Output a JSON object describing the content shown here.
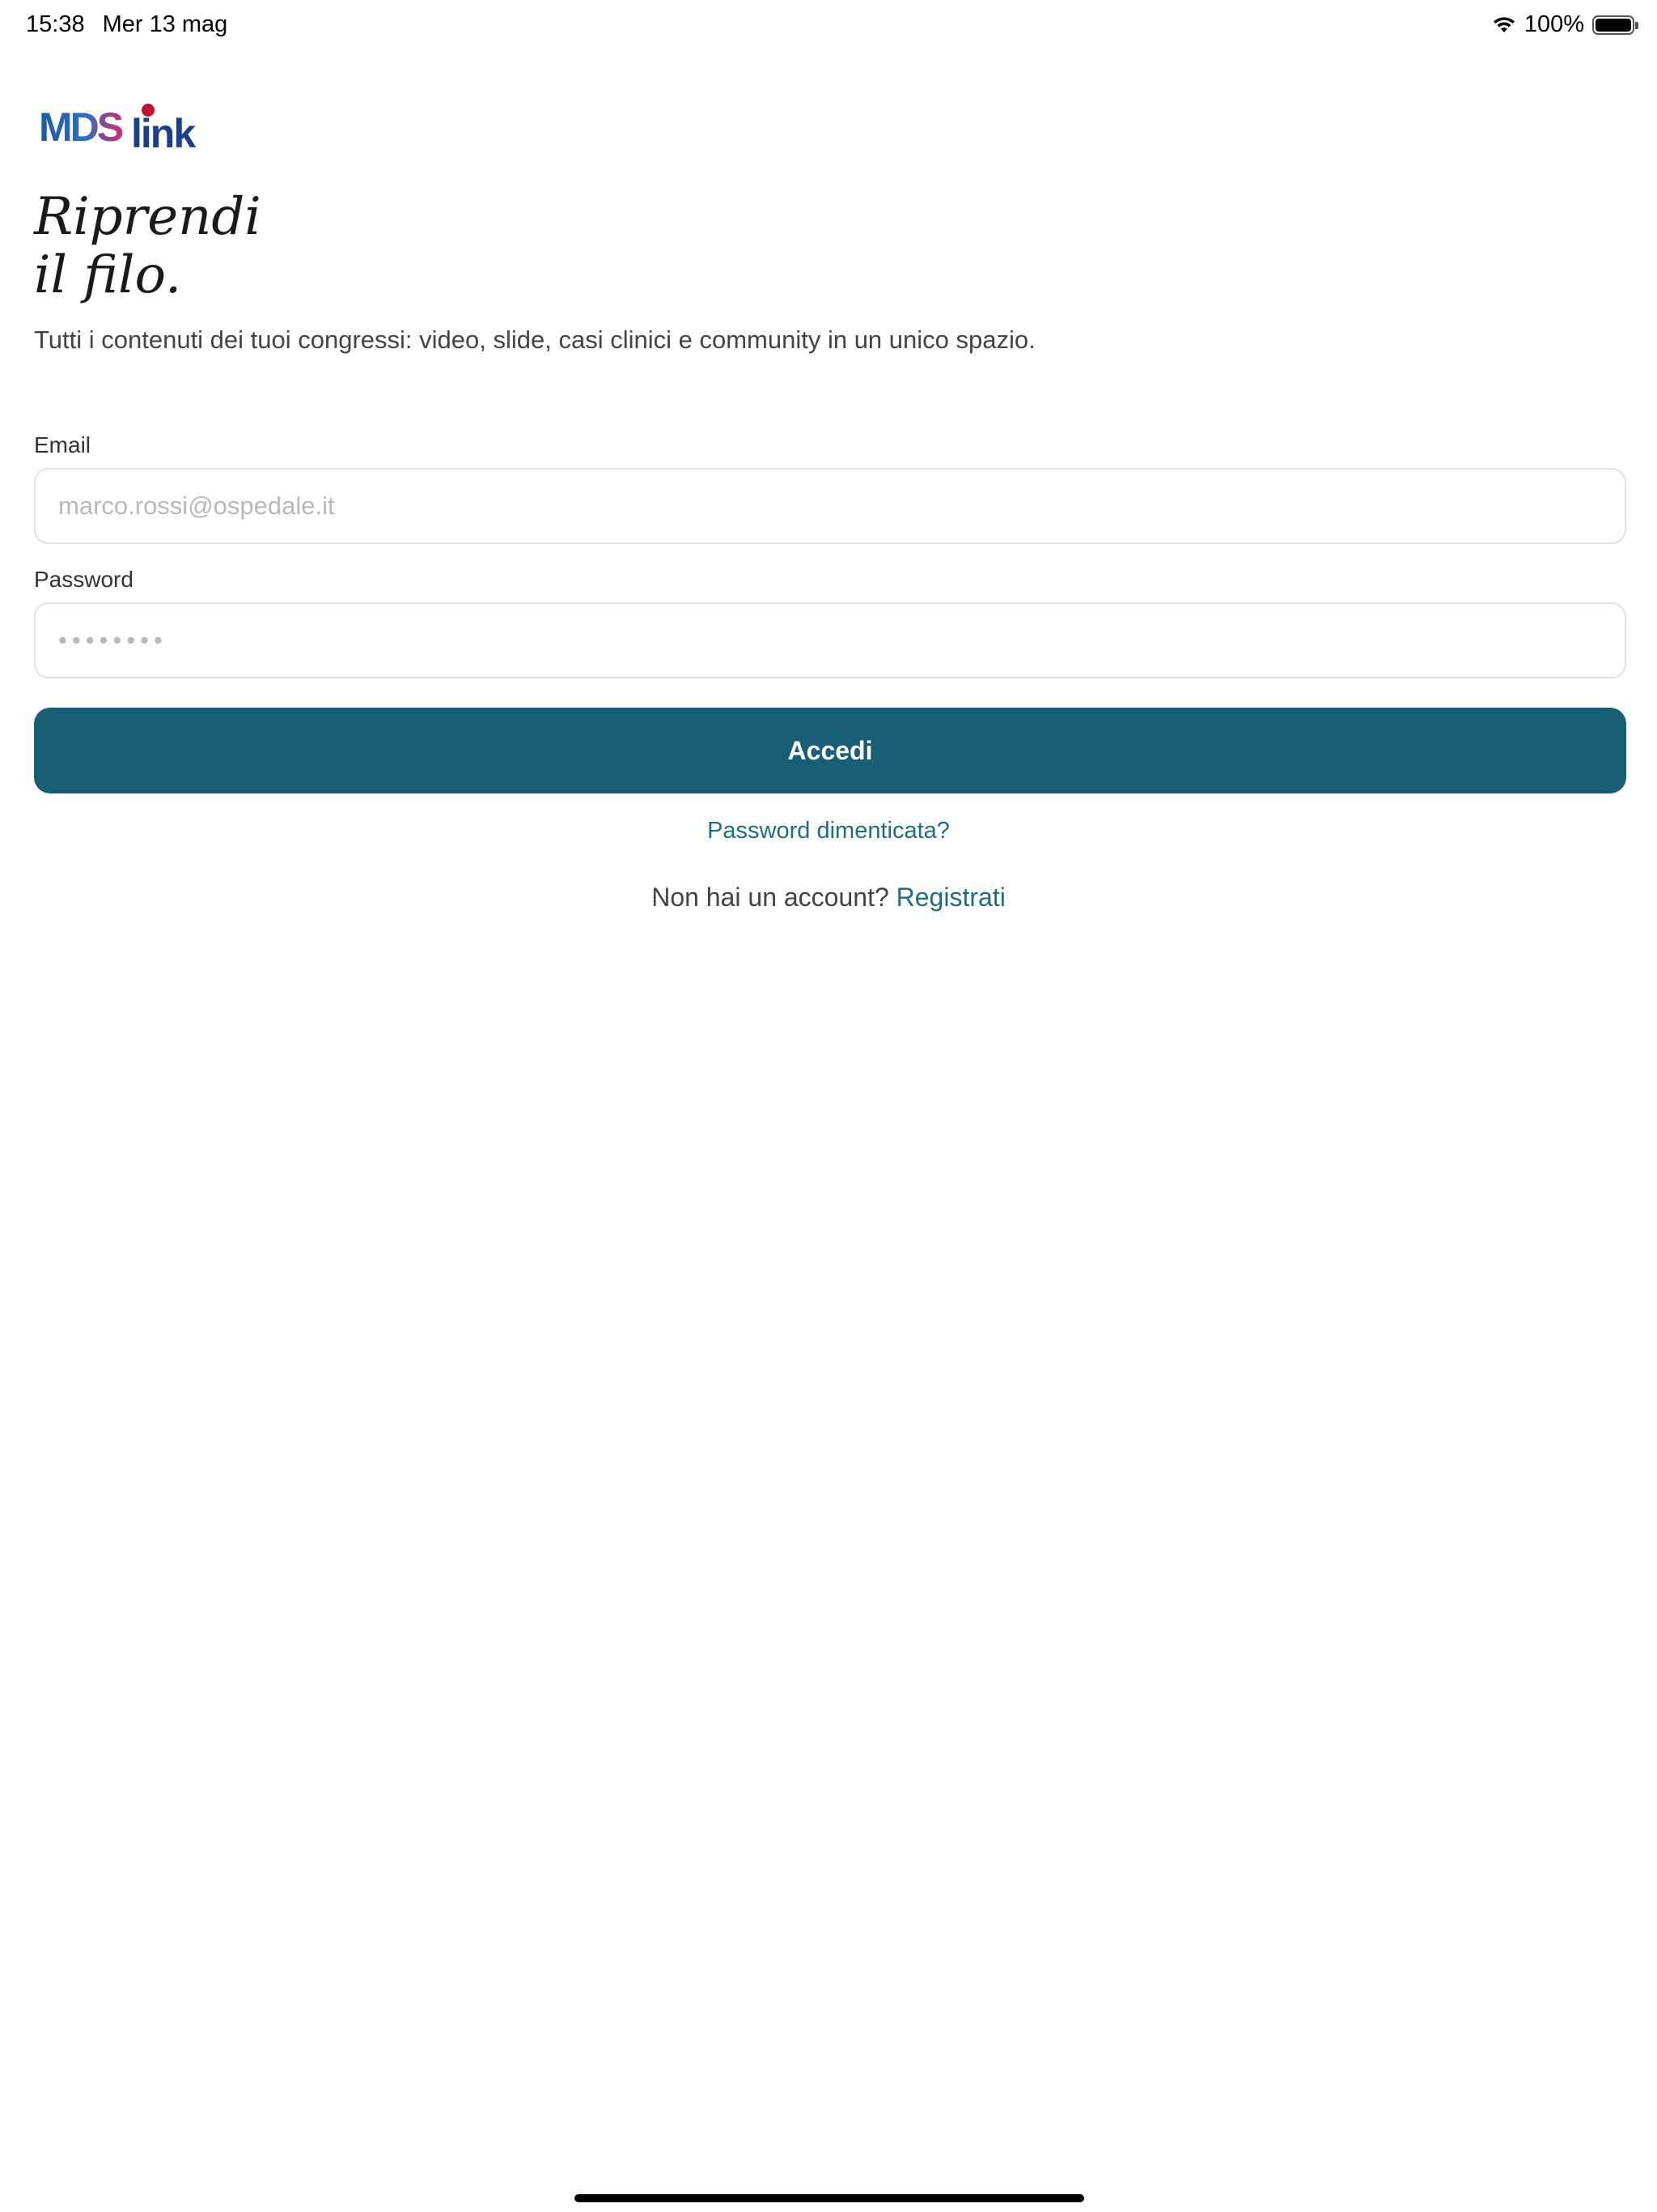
{
  "status_bar": {
    "time": "15:38",
    "date": "Mer 13 mag",
    "battery": "100%",
    "icons": [
      "wifi-icon",
      "battery-icon"
    ]
  },
  "logo": {
    "text_mds": "MDS",
    "text_link": "link",
    "colors": {
      "mds": "#1c5aa6",
      "accent": "#d22a6e",
      "link": "#1b3f8c",
      "dot": "#c8102e"
    }
  },
  "hero": {
    "title_line1": "Riprendi",
    "title_line2": "il filo.",
    "subtitle": "Tutti i contenuti dei tuoi congressi: video, slide, casi clinici e community in un unico spazio."
  },
  "form": {
    "email_label": "Email",
    "email_placeholder": "marco.rossi@ospedale.it",
    "email_value": "",
    "password_label": "Password",
    "password_placeholder": "••••••••",
    "password_value": "",
    "submit_label": "Accedi",
    "forgot_label": "Password dimenticata?",
    "no_account_text": "Non hai un account?",
    "register_label": "Registrati"
  },
  "theme": {
    "primary": "#185f75",
    "link": "#1e6e83",
    "border": "#e2e2e2"
  }
}
